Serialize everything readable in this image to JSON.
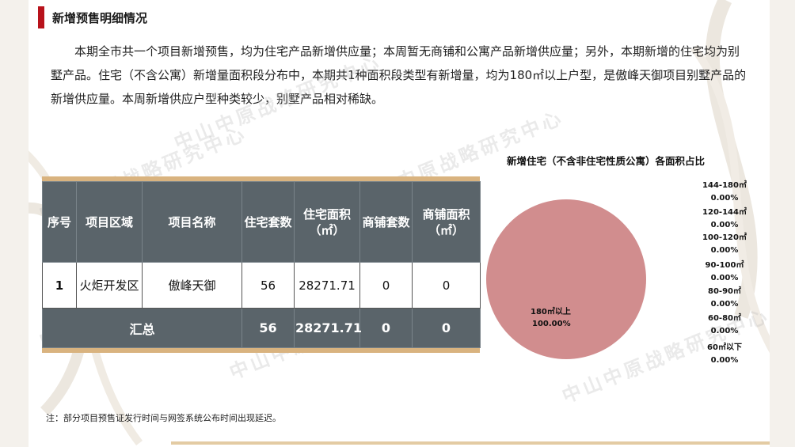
{
  "title": "新增预售明细情况",
  "paragraph": "本期全市共一个项目新增预售，均为住宅产品新增供应量；本周暂无商铺和公寓产品新增供应量；另外，本期新增的住宅均为别墅产品。住宅（不含公寓）新增量面积段分布中，本期共1种面积段类型有新增量，均为180㎡以上户型，是傲峰天御项目别墅产品的新增供应量。本周新增供应户型种类较少，别墅产品相对稀缺。",
  "watermark": "中山中原战略研究中心",
  "table": {
    "headers": [
      "序号",
      "项目区域",
      "项目名称",
      "住宅套数",
      "住宅面积（㎡）",
      "商铺套数",
      "商铺面积（㎡）"
    ],
    "rows": [
      [
        "1",
        "火炬开发区",
        "傲峰天御",
        "56",
        "28271.71",
        "0",
        "0"
      ]
    ],
    "summary": {
      "label": "汇总",
      "values": [
        "56",
        "28271.71",
        "0",
        "0"
      ]
    }
  },
  "chart_data": {
    "type": "pie",
    "title": "新增住宅（不含非住宅性质公寓）各面积占比",
    "slices": [
      {
        "label": "180㎡以上",
        "value": 100.0,
        "text": "100.00%",
        "color": "#d18d8e"
      },
      {
        "label": "144-180㎡",
        "value": 0.0,
        "text": "0.00%"
      },
      {
        "label": "120-144㎡",
        "value": 0.0,
        "text": "0.00%"
      },
      {
        "label": "100-120㎡",
        "value": 0.0,
        "text": "0.00%"
      },
      {
        "label": "90-100㎡",
        "value": 0.0,
        "text": "0.00%"
      },
      {
        "label": "80-90㎡",
        "value": 0.0,
        "text": "0.00%"
      },
      {
        "label": "60-80㎡",
        "value": 0.0,
        "text": "0.00%"
      },
      {
        "label": "60㎡以下",
        "value": 0.0,
        "text": "0.00%"
      }
    ]
  },
  "note": "注：部分项目预售证发行时间与网签系统公布时间出现延迟。",
  "colors": {
    "accent": "#b8121b",
    "header_bg": "#5a646a",
    "tan": "#d9b37f",
    "pie": "#d18d8e"
  }
}
